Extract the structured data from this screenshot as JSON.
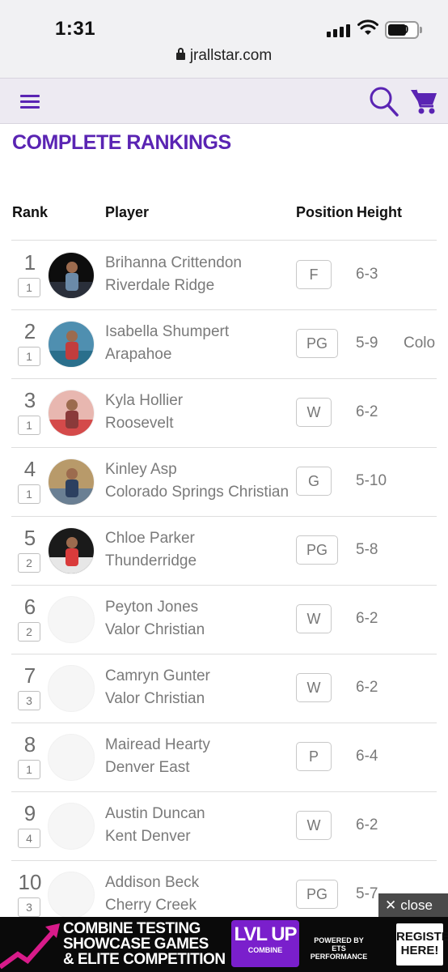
{
  "status": {
    "time": "1:31",
    "battery": "60"
  },
  "browser": {
    "url": "jrallstar.com"
  },
  "header": {
    "menu_icon": "hamburger-icon",
    "search_icon": "search-icon",
    "cart_icon": "cart-icon"
  },
  "page": {
    "title": "COMPLETE RANKINGS"
  },
  "columns": {
    "rank": "Rank",
    "player": "Player",
    "position": "Position",
    "height": "Height"
  },
  "players": [
    {
      "rank": "1",
      "prev": "1",
      "name": "Brihanna Crittendon",
      "school": "Riverdale Ridge",
      "position": "F",
      "height": "6-3",
      "extra": "",
      "photo": true
    },
    {
      "rank": "2",
      "prev": "1",
      "name": "Isabella Shumpert",
      "school": "Arapahoe",
      "position": "PG",
      "height": "5-9",
      "extra": "Colo",
      "photo": true
    },
    {
      "rank": "3",
      "prev": "1",
      "name": "Kyla Hollier",
      "school": "Roosevelt",
      "position": "W",
      "height": "6-2",
      "extra": "",
      "photo": true
    },
    {
      "rank": "4",
      "prev": "1",
      "name": "Kinley Asp",
      "school": "Colorado Springs Christian",
      "position": "G",
      "height": "5-10",
      "extra": "",
      "photo": true
    },
    {
      "rank": "5",
      "prev": "2",
      "name": "Chloe Parker",
      "school": "Thunderridge",
      "position": "PG",
      "height": "5-8",
      "extra": "",
      "photo": true
    },
    {
      "rank": "6",
      "prev": "2",
      "name": "Peyton Jones",
      "school": "Valor Christian",
      "position": "W",
      "height": "6-2",
      "extra": "",
      "photo": false
    },
    {
      "rank": "7",
      "prev": "3",
      "name": "Camryn Gunter",
      "school": "Valor Christian",
      "position": "W",
      "height": "6-2",
      "extra": "",
      "photo": false
    },
    {
      "rank": "8",
      "prev": "1",
      "name": "Mairead Hearty",
      "school": "Denver East",
      "position": "P",
      "height": "6-4",
      "extra": "",
      "photo": false
    },
    {
      "rank": "9",
      "prev": "4",
      "name": "Austin Duncan",
      "school": "Kent Denver",
      "position": "W",
      "height": "6-2",
      "extra": "",
      "photo": false
    },
    {
      "rank": "10",
      "prev": "3",
      "name": "Addison Beck",
      "school": "Cherry Creek",
      "position": "PG",
      "height": "5-7",
      "extra": "",
      "photo": false
    }
  ],
  "ad": {
    "line1": "COMBINE TESTING",
    "line2": "SHOWCASE GAMES",
    "line3": "& ELITE COMPETITION",
    "logo": "LVL UP",
    "logo_sub": "COMBINE",
    "powered": "POWERED BY",
    "powered_by": "ETS PERFORMANCE",
    "register": "REGISTER HERE!",
    "close_label": "close",
    "colors": {
      "accent": "#7a1fcc",
      "arrow": "#d81b8a"
    }
  },
  "colors": {
    "brand": "#5a24b3"
  }
}
